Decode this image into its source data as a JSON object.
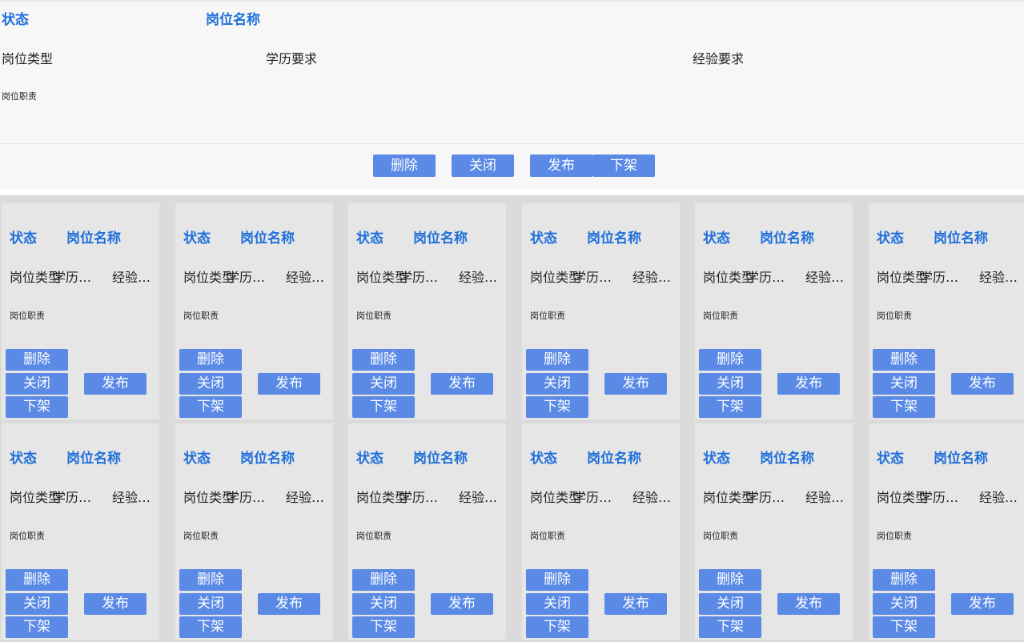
{
  "detail": {
    "status": "状态",
    "title": "岗位名称",
    "type": "岗位类型",
    "education": "学历要求",
    "experience": "经验要求",
    "duty": "岗位职责",
    "buttons": {
      "delete": "删除",
      "close": "关闭",
      "publish": "发布",
      "unpublish": "下架"
    }
  },
  "cards": [
    {
      "status": "状态",
      "title": "岗位名称",
      "type": "岗位类型",
      "education": "学历要求",
      "experience": "经验要求",
      "duty": "岗位职责",
      "delete": "删除",
      "close": "关闭",
      "publish": "发布",
      "unpublish": "下架"
    },
    {
      "status": "状态",
      "title": "岗位名称",
      "type": "岗位类型",
      "education": "学历要求",
      "experience": "经验要求",
      "duty": "岗位职责",
      "delete": "删除",
      "close": "关闭",
      "publish": "发布",
      "unpublish": "下架"
    },
    {
      "status": "状态",
      "title": "岗位名称",
      "type": "岗位类型",
      "education": "学历要求",
      "experience": "经验要求",
      "duty": "岗位职责",
      "delete": "删除",
      "close": "关闭",
      "publish": "发布",
      "unpublish": "下架"
    },
    {
      "status": "状态",
      "title": "岗位名称",
      "type": "岗位类型",
      "education": "学历要求",
      "experience": "经验要求",
      "duty": "岗位职责",
      "delete": "删除",
      "close": "关闭",
      "publish": "发布",
      "unpublish": "下架"
    },
    {
      "status": "状态",
      "title": "岗位名称",
      "type": "岗位类型",
      "education": "学历要求",
      "experience": "经验要求",
      "duty": "岗位职责",
      "delete": "删除",
      "close": "关闭",
      "publish": "发布",
      "unpublish": "下架"
    },
    {
      "status": "状态",
      "title": "岗位名称",
      "type": "岗位类型",
      "education": "学历要求",
      "experience": "经验要求",
      "duty": "岗位职责",
      "delete": "删除",
      "close": "关闭",
      "publish": "发布",
      "unpublish": "下架"
    },
    {
      "status": "状态",
      "title": "岗位名称",
      "type": "岗位类型",
      "education": "学历要求",
      "experience": "经验要求",
      "duty": "岗位职责",
      "delete": "删除",
      "close": "关闭",
      "publish": "发布",
      "unpublish": "下架"
    },
    {
      "status": "状态",
      "title": "岗位名称",
      "type": "岗位类型",
      "education": "学历要求",
      "experience": "经验要求",
      "duty": "岗位职责",
      "delete": "删除",
      "close": "关闭",
      "publish": "发布",
      "unpublish": "下架"
    },
    {
      "status": "状态",
      "title": "岗位名称",
      "type": "岗位类型",
      "education": "学历要求",
      "experience": "经验要求",
      "duty": "岗位职责",
      "delete": "删除",
      "close": "关闭",
      "publish": "发布",
      "unpublish": "下架"
    },
    {
      "status": "状态",
      "title": "岗位名称",
      "type": "岗位类型",
      "education": "学历要求",
      "experience": "经验要求",
      "duty": "岗位职责",
      "delete": "删除",
      "close": "关闭",
      "publish": "发布",
      "unpublish": "下架"
    },
    {
      "status": "状态",
      "title": "岗位名称",
      "type": "岗位类型",
      "education": "学历要求",
      "experience": "经验要求",
      "duty": "岗位职责",
      "delete": "删除",
      "close": "关闭",
      "publish": "发布",
      "unpublish": "下架"
    },
    {
      "status": "状态",
      "title": "岗位名称",
      "type": "岗位类型",
      "education": "学历要求",
      "experience": "经验要求",
      "duty": "岗位职责",
      "delete": "删除",
      "close": "关闭",
      "publish": "发布",
      "unpublish": "下架"
    }
  ],
  "colors": {
    "accent": "#1f6fdc",
    "button": "#5a8ae6",
    "card_bg": "#e6e6e6",
    "grid_bg": "#dcdbdb"
  }
}
